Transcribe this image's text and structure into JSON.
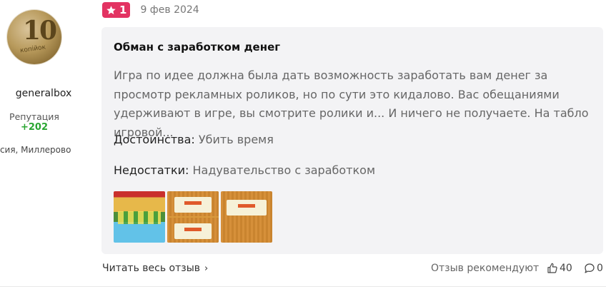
{
  "author": {
    "avatar_coin_number": "10",
    "avatar_coin_text": "копійок",
    "name": "generalbox",
    "reputation_label": "Репутация",
    "reputation_value": "+202",
    "location": "оссия, Миллерово"
  },
  "review": {
    "rating": "1",
    "date": "9 фев 2024",
    "title": "Обман с заработком денег",
    "text": "Игра по идее должна была дать возможность заработать вам денег за просмотр рекламных роликов, но по сути это кидалово. Вас обещаниями удерживают в игре, вы смотрите ролики и... И ничего не получаете. На табло игровой...",
    "pros_label": "Достоинства:",
    "pros_value": "Убить время",
    "cons_label": "Недостатки:",
    "cons_value": "Надувательство с заработком"
  },
  "footer": {
    "read_more": "Читать весь отзыв",
    "recommend_label": "Отзыв рекомендуют",
    "likes": "40",
    "comments": "0"
  },
  "colors": {
    "badge": "#e33362",
    "reputation": "#2aa632",
    "card_bg": "#f3f3f5"
  }
}
